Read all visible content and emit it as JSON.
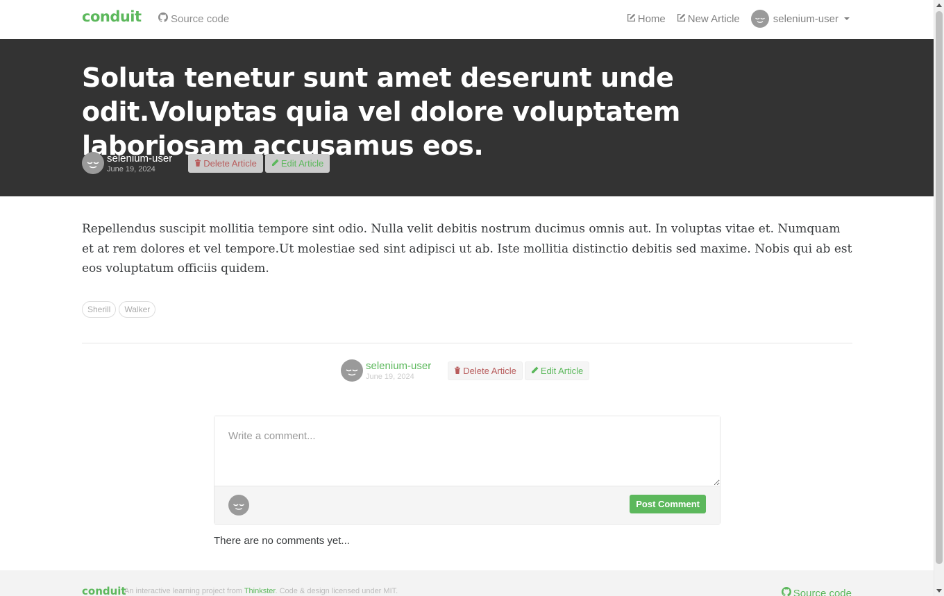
{
  "navbar": {
    "brand": "conduit",
    "source_code": "Source code",
    "home": "Home",
    "new_article": "New Article",
    "user": "selenium-user"
  },
  "article": {
    "title": "Soluta tenetur sunt amet deserunt unde odit.Voluptas quia vel dolore voluptatem laboriosam accusamus eos.",
    "author": "selenium-user",
    "date": "June 19, 2024",
    "delete_label": "Delete Article",
    "edit_label": "Edit Article",
    "body": "Repellendus suscipit mollitia tempore sint odio. Nulla velit debitis nostrum ducimus omnis aut. In voluptas vitae et. Numquam et at rem dolores et vel tempore.Ut molestiae sed sint adipisci ut ab. Iste mollitia distinctio debitis sed maxime. Nobis qui ab est eos voluptatum officiis quidem.",
    "tags": [
      "Sherill",
      "Walker"
    ]
  },
  "comments": {
    "placeholder": "Write a comment...",
    "post_label": "Post Comment",
    "empty_text": "There are no comments yet..."
  },
  "footer": {
    "brand": "conduit",
    "text_prefix": "An interactive learning project from ",
    "link_text": "Thinkster",
    "text_suffix": ". Code & design licensed under MIT.",
    "source_code": "Source code"
  },
  "colors": {
    "accent": "#5cb85c",
    "banner": "#333333",
    "danger": "#b85c5c"
  }
}
